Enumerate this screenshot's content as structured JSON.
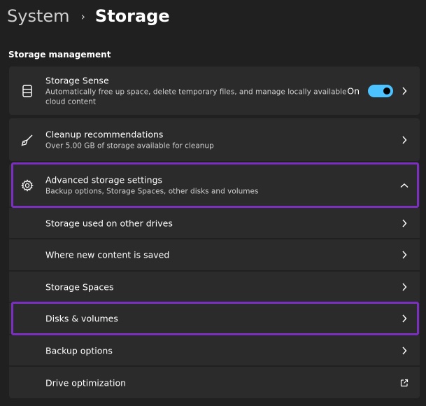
{
  "breadcrumb": {
    "parent": "System",
    "separator": "›",
    "current": "Storage"
  },
  "section_title": "Storage management",
  "storage_sense": {
    "title": "Storage Sense",
    "description_line1": "Automatically free up space, delete temporary files, and manage locally available",
    "description_line2": "cloud content",
    "toggle_label": "On",
    "toggle_on": true,
    "icon": "drive-icon"
  },
  "cleanup": {
    "title": "Cleanup recommendations",
    "description": "Over 5.00 GB of storage available for cleanup",
    "icon": "broom-icon"
  },
  "advanced": {
    "title": "Advanced storage settings",
    "description": "Backup options, Storage Spaces, other disks and volumes",
    "icon": "gear-icon",
    "expanded": true
  },
  "sub_items": [
    {
      "label": "Storage used on other drives"
    },
    {
      "label": "Where new content is saved"
    },
    {
      "label": "Storage Spaces"
    },
    {
      "label": "Disks & volumes"
    },
    {
      "label": "Backup options"
    },
    {
      "label": "Drive optimization"
    }
  ],
  "colors": {
    "background": "#202020",
    "card": "#2b2b2b",
    "accent": "#4cc2ff",
    "highlight": "#7b2fbe"
  }
}
